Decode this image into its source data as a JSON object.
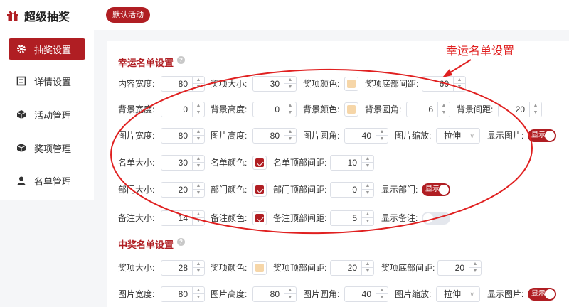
{
  "app": {
    "title": "超级抽奖",
    "activity_button": "默认活动"
  },
  "sidebar": {
    "items": [
      {
        "label": "抽奖设置",
        "icon": "gear-icon",
        "active": true
      },
      {
        "label": "详情设置",
        "icon": "document-icon",
        "active": false
      },
      {
        "label": "活动管理",
        "icon": "cube-icon",
        "active": false
      },
      {
        "label": "奖项管理",
        "icon": "cube-icon",
        "active": false
      },
      {
        "label": "名单管理",
        "icon": "user-icon",
        "active": false
      }
    ]
  },
  "annotation": {
    "text": "幸运名单设置"
  },
  "lucky": {
    "title": "幸运名单设置",
    "content_width": {
      "label": "内容宽度:",
      "value": "80"
    },
    "prize_size": {
      "label": "奖项大小:",
      "value": "30"
    },
    "prize_color": {
      "label": "奖项颜色:",
      "color": "#f6d6a8"
    },
    "prize_bottom_gap": {
      "label": "奖项底部间距:",
      "value": "60"
    },
    "bg_width": {
      "label": "背景宽度:",
      "value": "0"
    },
    "bg_height": {
      "label": "背景高度:",
      "value": "0"
    },
    "bg_color": {
      "label": "背景颜色:",
      "color": "#f6d6a8"
    },
    "bg_radius": {
      "label": "背景圆角:",
      "value": "6"
    },
    "bg_gap": {
      "label": "背景间距:",
      "value": "20"
    },
    "img_width": {
      "label": "图片宽度:",
      "value": "80"
    },
    "img_height": {
      "label": "图片高度:",
      "value": "80"
    },
    "img_radius": {
      "label": "图片圆角:",
      "value": "40"
    },
    "img_scale": {
      "label": "图片缩放:",
      "value": "拉伸"
    },
    "show_img": {
      "label": "显示图片:",
      "toggle": "显示",
      "on": true
    },
    "name_size": {
      "label": "名单大小:",
      "value": "30"
    },
    "name_color": {
      "label": "名单颜色:",
      "color": "#b01e23"
    },
    "name_top_gap": {
      "label": "名单顶部间距:",
      "value": "10"
    },
    "dept_size": {
      "label": "部门大小:",
      "value": "20"
    },
    "dept_color": {
      "label": "部门颜色:",
      "color": "#b01e23"
    },
    "dept_top_gap": {
      "label": "部门顶部间距:",
      "value": "0"
    },
    "show_dept": {
      "label": "显示部门:",
      "toggle": "显示",
      "on": true
    },
    "note_size": {
      "label": "备注大小:",
      "value": "14"
    },
    "note_color": {
      "label": "备注颜色:",
      "color": "#b01e23"
    },
    "note_top_gap": {
      "label": "备注顶部间距:",
      "value": "5"
    },
    "show_note": {
      "label": "显示备注:",
      "on": false
    }
  },
  "winner": {
    "title": "中奖名单设置",
    "prize_size": {
      "label": "奖项大小:",
      "value": "28"
    },
    "prize_color": {
      "label": "奖项颜色:",
      "color": "#f6d6a8"
    },
    "prize_top_gap": {
      "label": "奖项顶部间距:",
      "value": "20"
    },
    "prize_bottom_gap": {
      "label": "奖项底部间距:",
      "value": "20"
    },
    "img_width": {
      "label": "图片宽度:",
      "value": "80"
    },
    "img_height": {
      "label": "图片高度:",
      "value": "80"
    },
    "img_radius": {
      "label": "图片圆角:",
      "value": "40"
    },
    "img_scale": {
      "label": "图片缩放:",
      "value": "拉伸"
    },
    "show_img": {
      "label": "显示图片:",
      "toggle": "显示",
      "on": true
    }
  }
}
